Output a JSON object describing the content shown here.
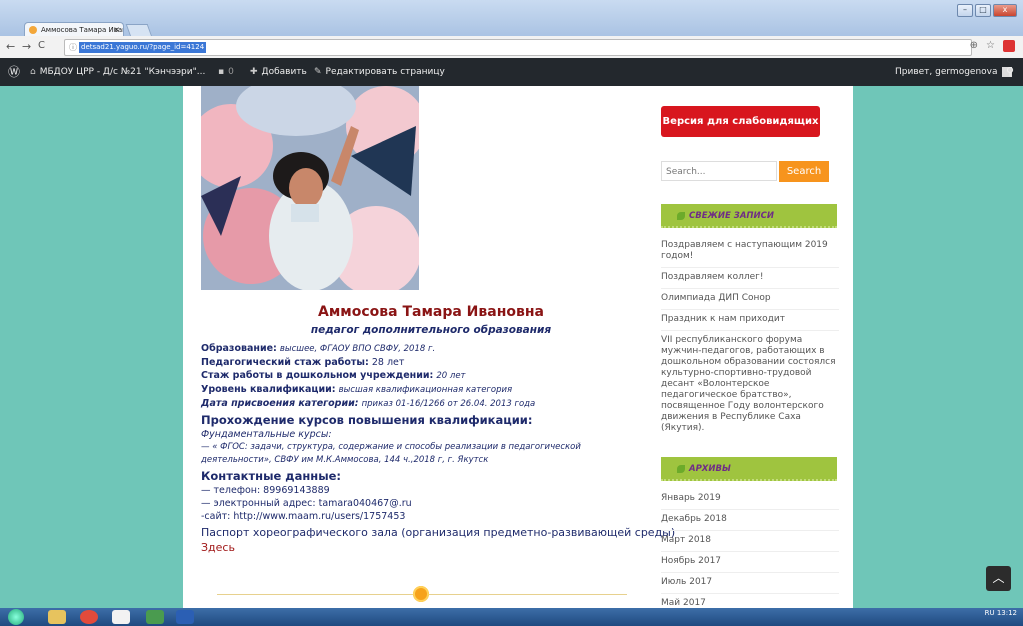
{
  "browser": {
    "tab_title": "Аммосова Тамара Иван",
    "tab_close": "×",
    "url": "detsad21.yaguo.ru/?page_id=4124",
    "nav": {
      "back": "←",
      "forward": "→",
      "reload": "C",
      "info": "ⓘ"
    },
    "zoom_icon": "⊕",
    "star_icon": "☆"
  },
  "admin_bar": {
    "wp_logo": "Ⓦ",
    "site_name": "МБДОУ ЦРР - Д/с №21 \"Кэнчээри\"...",
    "comments_count": "0",
    "add_label": "Добавить",
    "edit_label": "Редактировать страницу",
    "greeting": "Привет, germogenova",
    "search_icon": "⚲"
  },
  "profile": {
    "name": "Аммосова Тамара Ивановна",
    "role": "педагог дополнительного образования",
    "education_label": "Образование:",
    "education_value": "высшее,  ФГАОУ ВПО СВФУ, 2018 г.",
    "ped_experience_label": "Педагогический стаж работы:",
    "ped_experience_value": "28 лет",
    "dou_experience_label": "Стаж работы в дошкольном учреждении:",
    "dou_experience_value": "20 лет",
    "qualification_label": "Уровень квалификации:",
    "qualification_value": "высшая квалификационная категория",
    "category_date_label": "Дата присвоения категории:",
    "category_date_value": "приказ 01-16/1266 от 26.04. 2013 года",
    "courses_heading": "Прохождение курсов повышения квалификации:",
    "courses_subheading": "Фундаментальные курсы:",
    "course_line1": "— « ФГОС: задачи, структура, содержание и способы реализации в педагогической",
    "course_line2": "деятельности»,  СВФУ им М.К.Аммосова,  144 ч.,2018 г, г. Якутск",
    "contacts_heading": "Контактные данные:",
    "phone": "— телефон: 89969143889",
    "email": "— электронный адрес: tamara040467@.ru",
    "site": "-сайт: http://www.maam.ru/users/1757453",
    "passport": "Паспорт хореографического зала (организация предметно-развивающей среды)",
    "here_link": "Здесь"
  },
  "sidebar": {
    "vision_button": "Версия для слабовидящих",
    "search_placeholder": "Search...",
    "search_button": "Search",
    "recent_title": "СВЕЖИЕ ЗАПИСИ",
    "recent_posts": [
      "Поздравляем с наступающим 2019 годом!",
      "Поздравляем коллег!",
      "Олимпиада ДИП Сонор",
      "Праздник к нам приходит",
      "VII республиканского форума мужчин-педагогов, работающих в дошкольном образовании состоялся культурно-спортивно-трудовой десант «Волонтерское педагогическое братство», посвященное Году волонтерского движения в Республике Саха (Якутия)."
    ],
    "archive_title": "АРХИВЫ",
    "archives": [
      "Январь 2019",
      "Декабрь 2018",
      "Март 2018",
      "Ноябрь 2017",
      "Июль 2017",
      "Май 2017"
    ]
  },
  "taskbar": {
    "tray_lang": "RU",
    "time": "13:12"
  }
}
